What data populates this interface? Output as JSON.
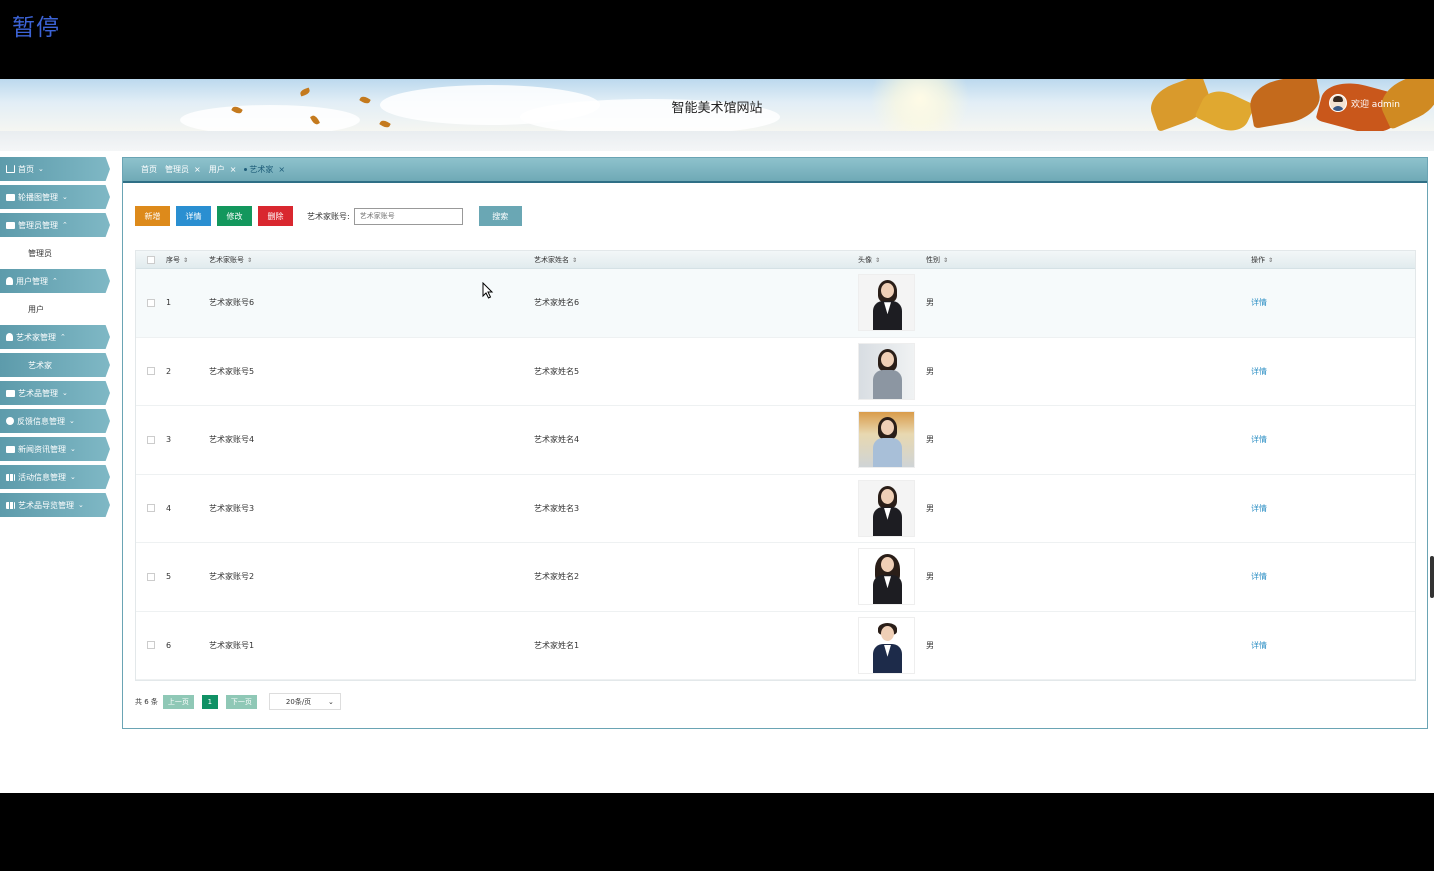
{
  "overlay": {
    "pause_label": "暂停"
  },
  "header": {
    "site_title": "智能美术馆网站",
    "welcome": "欢迎 admin"
  },
  "sidebar": {
    "items": [
      {
        "label": "首页",
        "caret": "⌄",
        "icon": "home-icon"
      },
      {
        "label": "轮播图管理",
        "caret": "⌄",
        "icon": "image-icon"
      },
      {
        "label": "管理员管理",
        "caret": "⌃",
        "icon": "admin-icon",
        "children": [
          "管理员"
        ]
      },
      {
        "label": "用户管理",
        "caret": "⌃",
        "icon": "user-icon",
        "children": [
          "用户"
        ]
      },
      {
        "label": "艺术家管理",
        "caret": "⌃",
        "icon": "artist-icon",
        "children": [
          "艺术家"
        ]
      },
      {
        "label": "艺术品管理",
        "caret": "⌄",
        "icon": "artwork-icon"
      },
      {
        "label": "反馈信息管理",
        "caret": "⌄",
        "icon": "feedback-icon"
      },
      {
        "label": "新闻资讯管理",
        "caret": "⌄",
        "icon": "news-icon"
      },
      {
        "label": "活动信息管理",
        "caret": "⌄",
        "icon": "activity-icon"
      },
      {
        "label": "艺术品导览管理",
        "caret": "⌄",
        "icon": "guide-icon"
      }
    ]
  },
  "tabs": [
    {
      "label": "首页",
      "closable": false
    },
    {
      "label": "管理员",
      "closable": true
    },
    {
      "label": "用户",
      "closable": true
    },
    {
      "label": "艺术家",
      "closable": true,
      "active": true
    }
  ],
  "tab_close": "×",
  "toolbar": {
    "add": "新增",
    "detail": "详情",
    "edit": "修改",
    "delete": "删除",
    "search_label": "艺术家账号:",
    "search_placeholder": "艺术家账号",
    "search_button": "搜索"
  },
  "table": {
    "columns": [
      "序号",
      "艺术家账号",
      "艺术家姓名",
      "头像",
      "性别",
      "操作"
    ],
    "sort_glyph": "⇕",
    "rows": [
      {
        "no": "1",
        "account": "艺术家账号6",
        "name": "艺术家姓名6",
        "sex": "男",
        "op": "详情"
      },
      {
        "no": "2",
        "account": "艺术家账号5",
        "name": "艺术家姓名5",
        "sex": "男",
        "op": "详情"
      },
      {
        "no": "3",
        "account": "艺术家账号4",
        "name": "艺术家姓名4",
        "sex": "男",
        "op": "详情"
      },
      {
        "no": "4",
        "account": "艺术家账号3",
        "name": "艺术家姓名3",
        "sex": "男",
        "op": "详情"
      },
      {
        "no": "5",
        "account": "艺术家账号2",
        "name": "艺术家姓名2",
        "sex": "男",
        "op": "详情"
      },
      {
        "no": "6",
        "account": "艺术家账号1",
        "name": "艺术家姓名1",
        "sex": "男",
        "op": "详情"
      }
    ]
  },
  "pager": {
    "total": "共 6 条",
    "prev": "上一页",
    "current": "1",
    "next": "下一页",
    "page_size": "20条/页",
    "dropdown_glyph": "⌄"
  },
  "colors": {
    "accent": "#6aa7b4",
    "add": "#dd8a1b",
    "detail": "#2a8fd1",
    "edit": "#13975d",
    "delete": "#d9272f"
  }
}
